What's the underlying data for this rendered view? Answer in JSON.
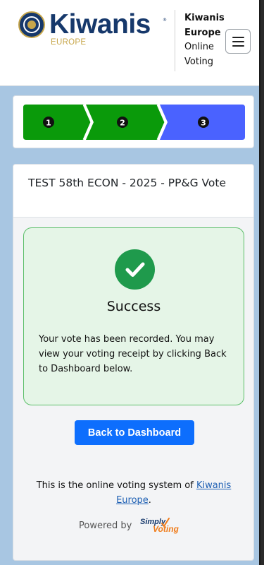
{
  "header": {
    "logo_word": "Kiwanis",
    "logo_sub": "EUROPE",
    "site_name_bold_1": "Kiwanis",
    "site_name_bold_2": "Europe",
    "site_name_1": "Online",
    "site_name_2": "Voting",
    "menu_icon": "hamburger-menu-icon"
  },
  "stepper": {
    "steps": [
      {
        "label": "1",
        "state": "complete",
        "color": "#0a9a0a"
      },
      {
        "label": "2",
        "state": "complete",
        "color": "#0a9a0a"
      },
      {
        "label": "3",
        "state": "current",
        "color": "#4a62ff"
      }
    ]
  },
  "card": {
    "title": "TEST 58th ECON - 2025 - PP&G Vote",
    "success": {
      "icon": "check-circle-icon",
      "title": "Success",
      "message": "Your vote has been recorded. You may view your voting receipt by clicking Back to Dashboard below."
    },
    "dashboard_button": "Back to Dashboard",
    "footer": {
      "text_before": "This is the online voting system of ",
      "link": "Kiwanis Europe",
      "text_after": "."
    },
    "powered_by": "Powered by",
    "powered_brand_1": "Simply",
    "powered_brand_2": "Voting"
  },
  "colors": {
    "brand_navy": "#16386b",
    "brand_gold": "#c7a64a",
    "step_complete": "#0a9a0a",
    "step_current": "#4a62ff",
    "success_green": "#1f9a4c",
    "primary_button": "#0d6efd"
  }
}
